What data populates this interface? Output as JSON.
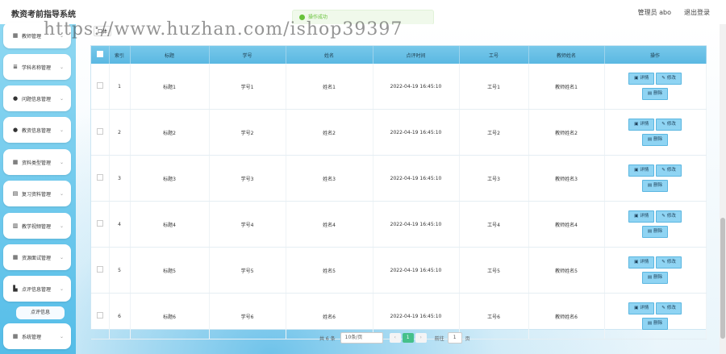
{
  "header": {
    "title": "教资考前指导系统",
    "admin": "管理员 abo",
    "logout": "退出登录"
  },
  "toast": {
    "text": "操作成功"
  },
  "watermark": "https://www.huzhan.com/ishop39397",
  "tags": {
    "current": "口体"
  },
  "sidebar": {
    "items": [
      {
        "icon": "grid-icon",
        "glyph": "▦",
        "label": "教师管理"
      },
      {
        "icon": "subject-icon",
        "glyph": "≣",
        "label": "学科名称管理"
      },
      {
        "icon": "user-icon",
        "glyph": "●",
        "label": "问题信息管理"
      },
      {
        "icon": "user-icon",
        "glyph": "●",
        "label": "教资信息管理"
      },
      {
        "icon": "grid-icon",
        "glyph": "▦",
        "label": "资料类型管理"
      },
      {
        "icon": "list-icon",
        "glyph": "▤",
        "label": "复习资料管理"
      },
      {
        "icon": "chart-icon",
        "glyph": "▥",
        "label": "教学视频管理"
      },
      {
        "icon": "grid-icon",
        "glyph": "▦",
        "label": "资源面试管理"
      },
      {
        "icon": "comment-icon",
        "glyph": "▙",
        "label": "点评信息管理"
      },
      {
        "icon": "grid-icon",
        "glyph": "▦",
        "label": "系统管理"
      }
    ],
    "sub_item": "点评信息"
  },
  "table": {
    "headers": [
      "索引",
      "标题",
      "学号",
      "姓名",
      "点评时间",
      "工号",
      "教师姓名",
      "操作"
    ],
    "rows": [
      {
        "index": "1",
        "title": "标题1",
        "student_no": "学号1",
        "name": "姓名1",
        "time": "2022-04-19 16:45:10",
        "staff_no": "工号1",
        "teacher": "教师姓名1"
      },
      {
        "index": "2",
        "title": "标题2",
        "student_no": "学号2",
        "name": "姓名2",
        "time": "2022-04-19 16:45:10",
        "staff_no": "工号2",
        "teacher": "教师姓名2"
      },
      {
        "index": "3",
        "title": "标题3",
        "student_no": "学号3",
        "name": "姓名3",
        "time": "2022-04-19 16:45:10",
        "staff_no": "工号3",
        "teacher": "教师姓名3"
      },
      {
        "index": "4",
        "title": "标题4",
        "student_no": "学号4",
        "name": "姓名4",
        "time": "2022-04-19 16:45:10",
        "staff_no": "工号4",
        "teacher": "教师姓名4"
      },
      {
        "index": "5",
        "title": "标题5",
        "student_no": "学号5",
        "name": "姓名5",
        "time": "2022-04-19 16:45:10",
        "staff_no": "工号5",
        "teacher": "教师姓名5"
      },
      {
        "index": "6",
        "title": "标题6",
        "student_no": "学号6",
        "name": "姓名6",
        "time": "2022-04-19 16:45:10",
        "staff_no": "工号6",
        "teacher": "教师姓名6"
      }
    ],
    "actions": {
      "detail": "详情",
      "edit": "修改",
      "delete": "删除"
    }
  },
  "pagination": {
    "total": "共 6 条",
    "page_size": "10条/页",
    "current": "1",
    "goto_label": "前往",
    "goto_value": "1",
    "page_suffix": "页"
  },
  "colors": {
    "accent": "#5ab8e2",
    "sidebar": "#55bde8",
    "current_page": "#45c08a",
    "toast": "#67c23a"
  }
}
